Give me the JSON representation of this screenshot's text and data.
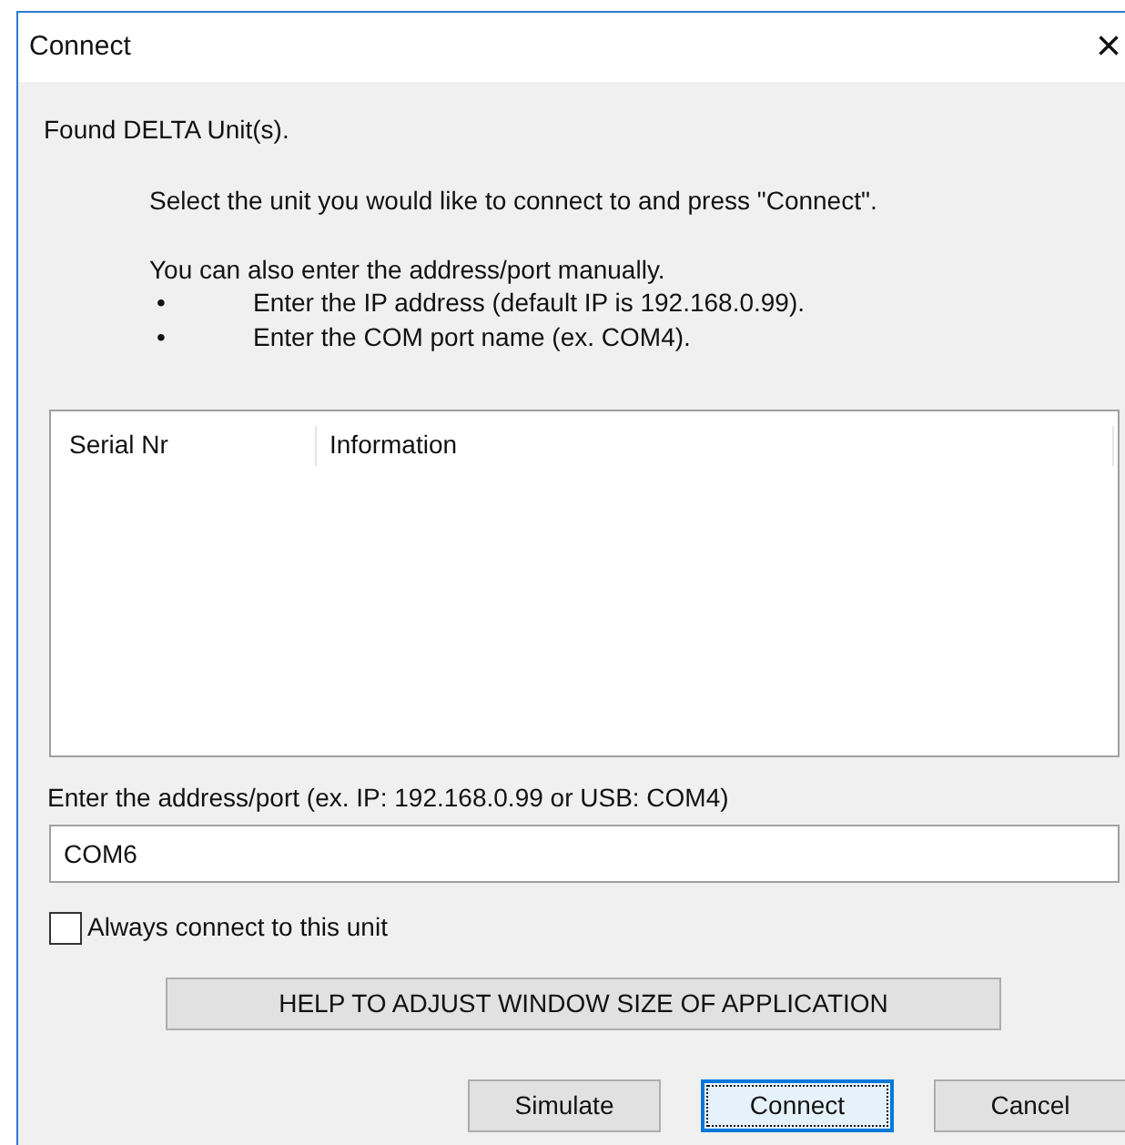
{
  "window": {
    "title": "Connect",
    "close": "×"
  },
  "found": "Found DELTA Unit(s).",
  "instruction": "Select the unit you would like to connect to and press \"Connect\".",
  "manual": "You can also enter the address/port manually.",
  "bullets": [
    {
      "marker": "•",
      "text": "Enter the IP address (default IP is 192.168.0.99)."
    },
    {
      "marker": "•",
      "text": "Enter the COM port name (ex. COM4)."
    }
  ],
  "table": {
    "columns": [
      "Serial Nr",
      "Information"
    ]
  },
  "address": {
    "label": "Enter the address/port (ex. IP: 192.168.0.99 or USB: COM4)",
    "value": "COM6"
  },
  "always_connect": {
    "label": "Always connect to this unit",
    "checked": false
  },
  "help_button": "HELP TO ADJUST WINDOW SIZE OF APPLICATION",
  "buttons": [
    {
      "label": "Simulate",
      "focused": false
    },
    {
      "label": "Connect",
      "focused": true
    },
    {
      "label": "Cancel",
      "focused": false
    }
  ]
}
